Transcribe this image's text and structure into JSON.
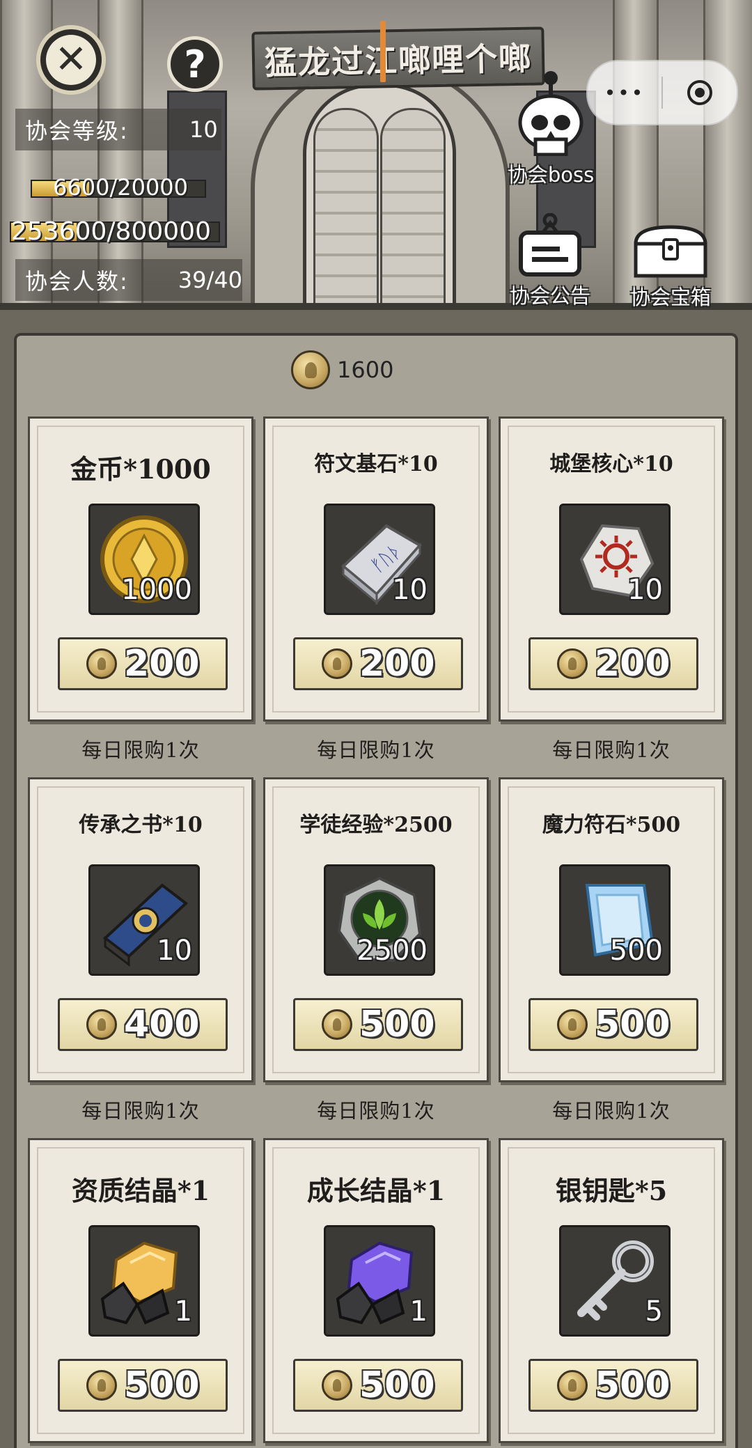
{
  "header": {
    "guild_name": "猛龙过江啷哩个啷",
    "close_icon": "close-icon",
    "help_icon": "help-icon",
    "capsule": {
      "more_icon": "more-dots-icon",
      "dots": "•••",
      "record_icon": "record-icon"
    }
  },
  "guild_stats": {
    "level_label": "协会等级:",
    "level_value": "10",
    "exp_text": "6600/20000",
    "exp_progress": 0.33,
    "fund_text": "253600/800000",
    "fund_progress": 0.317,
    "members_label": "协会人数:",
    "members_value": "39/40"
  },
  "side_buttons": {
    "boss_label": "协会boss",
    "notice_label": "协会公告",
    "chest_label": "协会宝箱"
  },
  "shop": {
    "balance": "1600",
    "currency_icon": "guild-coin-icon",
    "items": [
      {
        "name": "金币*1000",
        "qty": "1000",
        "price": "200",
        "limit": "每日限购1次",
        "icon": "gold-coin-icon"
      },
      {
        "name": "符文基石*10",
        "qty": "10",
        "price": "200",
        "limit": "每日限购1次",
        "icon": "rune-stone-icon"
      },
      {
        "name": "城堡核心*10",
        "qty": "10",
        "price": "200",
        "limit": "每日限购1次",
        "icon": "castle-core-icon"
      },
      {
        "name": "传承之书*10",
        "qty": "10",
        "price": "400",
        "limit": "每日限购1次",
        "icon": "book-icon"
      },
      {
        "name": "学徒经验*2500",
        "qty": "2500",
        "price": "500",
        "limit": "每日限购1次",
        "icon": "apprentice-exp-icon"
      },
      {
        "name": "魔力符石*500",
        "qty": "500",
        "price": "500",
        "limit": "每日限购1次",
        "icon": "mana-crystal-icon"
      },
      {
        "name": "资质结晶*1",
        "qty": "1",
        "price": "500",
        "limit": "",
        "icon": "aptitude-crystal-icon"
      },
      {
        "name": "成长结晶*1",
        "qty": "1",
        "price": "500",
        "limit": "",
        "icon": "growth-crystal-icon"
      },
      {
        "name": "银钥匙*5",
        "qty": "5",
        "price": "500",
        "limit": "",
        "icon": "silver-key-icon"
      }
    ]
  },
  "colors": {
    "panel_bg": "#a8a397",
    "card_bg": "#ede9df",
    "price_bg": "#f0e6bd",
    "accent_caret": "#e08a3a"
  }
}
